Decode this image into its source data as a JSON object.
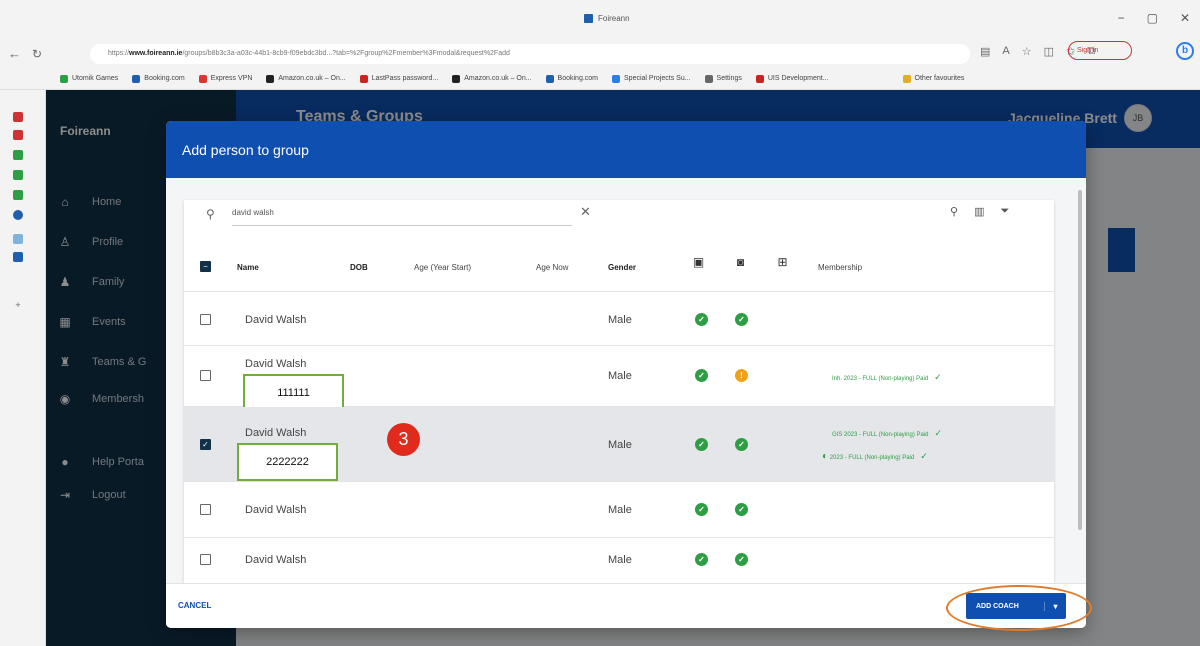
{
  "browser": {
    "tab_title": "Foireann",
    "url_prefix": "https://",
    "url_domain": "www.foireann.ie",
    "url_rest": "/groups/b8b3c3a-a03c-44b1-8cb9-f09ebdc3bd...?tab=%2Fgroup%2Fmember%3Fmodal&request%2Fadd",
    "window_controls": [
      "−",
      "▢",
      "✕"
    ],
    "signin_label": "Sign in",
    "bookmarks": [
      {
        "label": "Utomik Games",
        "color": "#2e9e45"
      },
      {
        "label": "Booking.com",
        "color": "#1f5fae"
      },
      {
        "label": "Express VPN",
        "color": "#d33"
      },
      {
        "label": "Amazon.co.uk – On...",
        "color": "#222"
      },
      {
        "label": "LastPass password...",
        "color": "#c22"
      },
      {
        "label": "Amazon.co.uk – On...",
        "color": "#222"
      },
      {
        "label": "Booking.com",
        "color": "#1f5fae"
      },
      {
        "label": "Special Projects Su...",
        "color": "#2b7de9"
      },
      {
        "label": "Settings",
        "color": "#666"
      },
      {
        "label": "UIS Development...",
        "color": "#c22"
      },
      {
        "label": "Other favourites",
        "color": "#e0b020"
      }
    ]
  },
  "app": {
    "brand": "Foireann",
    "page_title": "Teams & Groups",
    "user_name": "Jacqueline Brett",
    "user_initials": "JB",
    "nav": [
      {
        "icon": "home-icon",
        "glyph": "⌂",
        "label": "Home"
      },
      {
        "icon": "profile-icon",
        "glyph": "●",
        "label": "Profile"
      },
      {
        "icon": "family-icon",
        "glyph": "♟",
        "label": "Family"
      },
      {
        "icon": "events-icon",
        "glyph": "▦",
        "label": "Events"
      },
      {
        "icon": "teams-icon",
        "glyph": "♜",
        "label": "Teams & G"
      },
      {
        "icon": "membership-icon",
        "glyph": "◉",
        "label": "Membersh"
      },
      {
        "icon": "help-icon",
        "glyph": "●",
        "label": "Help Porta"
      },
      {
        "icon": "logout-icon",
        "glyph": "⇥",
        "label": "Logout"
      }
    ]
  },
  "dialog": {
    "title": "Add person to group",
    "search_value": "david walsh",
    "columns": {
      "name": "Name",
      "dob": "DOB",
      "age_year_start": "Age (Year Start)",
      "age_now": "Age Now",
      "gender": "Gender",
      "membership": "Membership"
    },
    "rows": [
      {
        "name": "David Walsh",
        "gender": "Male",
        "checked": false,
        "status1": "ok",
        "status2": "ok",
        "memberships": [],
        "id": ""
      },
      {
        "name": "David Walsh",
        "gender": "Male",
        "checked": false,
        "status1": "ok",
        "status2": "warn",
        "memberships": [
          "Inh. 2023 - FULL (Non-playing) Paid"
        ],
        "id": "111111"
      },
      {
        "name": "David Walsh",
        "gender": "Male",
        "checked": true,
        "status1": "ok",
        "status2": "ok",
        "memberships": [
          "GIS 2023 - FULL (Non-playing) Paid",
          "2023 - FULL (Non-playing) Paid"
        ],
        "id": "2222222"
      },
      {
        "name": "David Walsh",
        "gender": "Male",
        "checked": false,
        "status1": "ok",
        "status2": "ok",
        "memberships": [],
        "id": ""
      },
      {
        "name": "David Walsh",
        "gender": "Male",
        "checked": false,
        "status1": "ok",
        "status2": "ok",
        "memberships": [],
        "id": ""
      }
    ],
    "step_marker": "3",
    "cancel_label": "CANCEL",
    "add_label": "ADD COACH",
    "add_dropdown": "▾"
  },
  "colors": {
    "primary": "#0f4fb0",
    "sidebar": "#123047",
    "ok": "#2e9e45",
    "warn": "#f0a21a",
    "annotation_box": "#6fae3c",
    "annotation_ring": "#e07b2a",
    "step_marker": "#e02a1c"
  }
}
